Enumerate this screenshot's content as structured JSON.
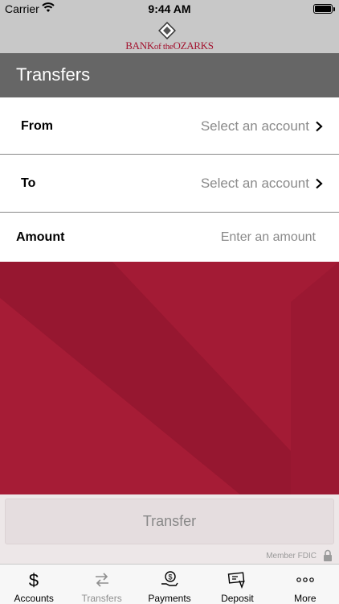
{
  "status_bar": {
    "carrier": "Carrier",
    "time": "9:44 AM",
    "icons": [
      "wifi-icon",
      "battery-icon"
    ]
  },
  "header": {
    "logo_text_1": "BANK",
    "logo_text_2": "of the",
    "logo_text_3": "OZARKS",
    "brand_color": "#a3132f"
  },
  "title_bar": {
    "title": "Transfers"
  },
  "form": {
    "from": {
      "label": "From",
      "value": "Select an account"
    },
    "to": {
      "label": "To",
      "value": "Select an account"
    },
    "amount": {
      "label": "Amount",
      "placeholder": "Enter an amount",
      "value": ""
    }
  },
  "actions": {
    "transfer_label": "Transfer"
  },
  "footer": {
    "fdic_text": "Member FDIC"
  },
  "tab_bar": {
    "tabs": [
      {
        "label": "Accounts",
        "icon": "dollar-icon",
        "active": false
      },
      {
        "label": "Transfers",
        "icon": "transfer-arrows-icon",
        "active": true
      },
      {
        "label": "Payments",
        "icon": "payment-hand-icon",
        "active": false
      },
      {
        "label": "Deposit",
        "icon": "check-deposit-icon",
        "active": false
      },
      {
        "label": "More",
        "icon": "more-dots-icon",
        "active": false
      }
    ]
  },
  "colors": {
    "banner": "#a11a33",
    "title_bar": "#666666",
    "header_bg": "#c8c8c8"
  }
}
